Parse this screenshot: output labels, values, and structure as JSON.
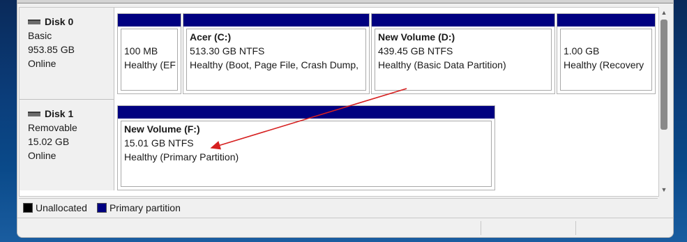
{
  "disks": [
    {
      "name": "Disk 0",
      "type": "Basic",
      "size": "953.85 GB",
      "status": "Online",
      "partitions": [
        {
          "title": "",
          "size": "100 MB",
          "health": "Healthy (EF"
        },
        {
          "title": "Acer  (C:)",
          "size": "513.30 GB NTFS",
          "health": "Healthy (Boot, Page File, Crash Dump,"
        },
        {
          "title": "New Volume  (D:)",
          "size": "439.45 GB NTFS",
          "health": "Healthy (Basic Data Partition)"
        },
        {
          "title": "",
          "size": "1.00 GB",
          "health": "Healthy (Recovery"
        }
      ]
    },
    {
      "name": "Disk 1",
      "type": "Removable",
      "size": "15.02 GB",
      "status": "Online",
      "partitions": [
        {
          "title": "New Volume  (F:)",
          "size": "15.01 GB NTFS",
          "health": "Healthy (Primary Partition)"
        }
      ]
    }
  ],
  "legend": {
    "unallocated": "Unallocated",
    "primary": "Primary partition",
    "unallocated_color": "#000000",
    "primary_color": "#000080"
  },
  "annotation_color": "#d62020"
}
